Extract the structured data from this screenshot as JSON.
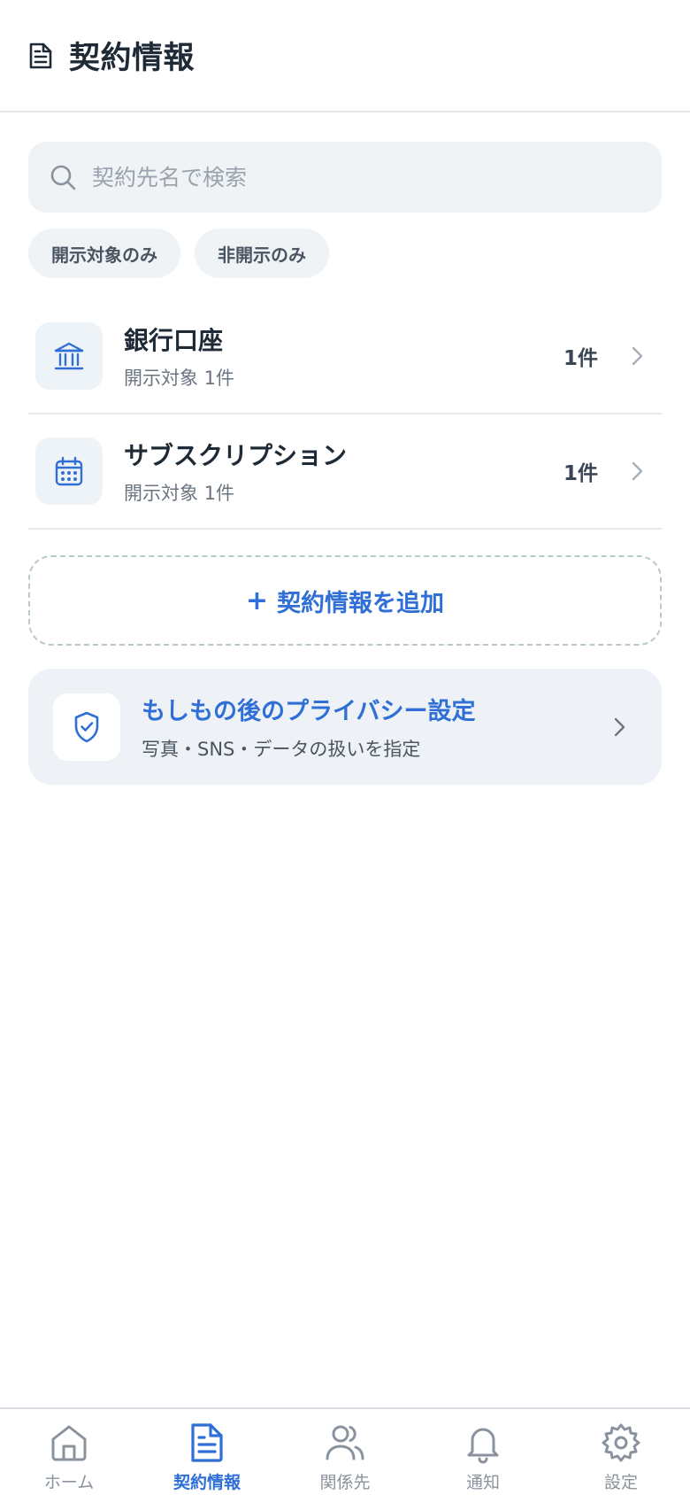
{
  "header": {
    "title": "契約情報",
    "icon": "document-icon"
  },
  "search": {
    "placeholder": "契約先名で検索",
    "value": ""
  },
  "filters": [
    {
      "label": "開示対象のみ"
    },
    {
      "label": "非開示のみ"
    }
  ],
  "categories": [
    {
      "title": "銀行口座",
      "subtitle": "開示対象 1件",
      "count": "1件",
      "icon": "bank-icon"
    },
    {
      "title": "サブスクリプション",
      "subtitle": "開示対象 1件",
      "count": "1件",
      "icon": "calendar-icon"
    }
  ],
  "add_button": {
    "plus": "+",
    "label": "契約情報を追加"
  },
  "privacy_card": {
    "title": "もしもの後のプライバシー設定",
    "subtitle": "写真・SNS・データの扱いを指定",
    "icon": "shield-check-icon"
  },
  "tabbar": {
    "active": "契約情報",
    "items": [
      {
        "label": "ホーム",
        "icon": "home-icon"
      },
      {
        "label": "契約情報",
        "icon": "document-icon"
      },
      {
        "label": "関係先",
        "icon": "people-icon"
      },
      {
        "label": "通知",
        "icon": "bell-icon"
      },
      {
        "label": "設定",
        "icon": "gear-icon"
      }
    ]
  },
  "colors": {
    "accent": "#2f6fd6",
    "text": "#1f2a37",
    "muted": "#6b7580",
    "surface": "#f0f3f6"
  }
}
